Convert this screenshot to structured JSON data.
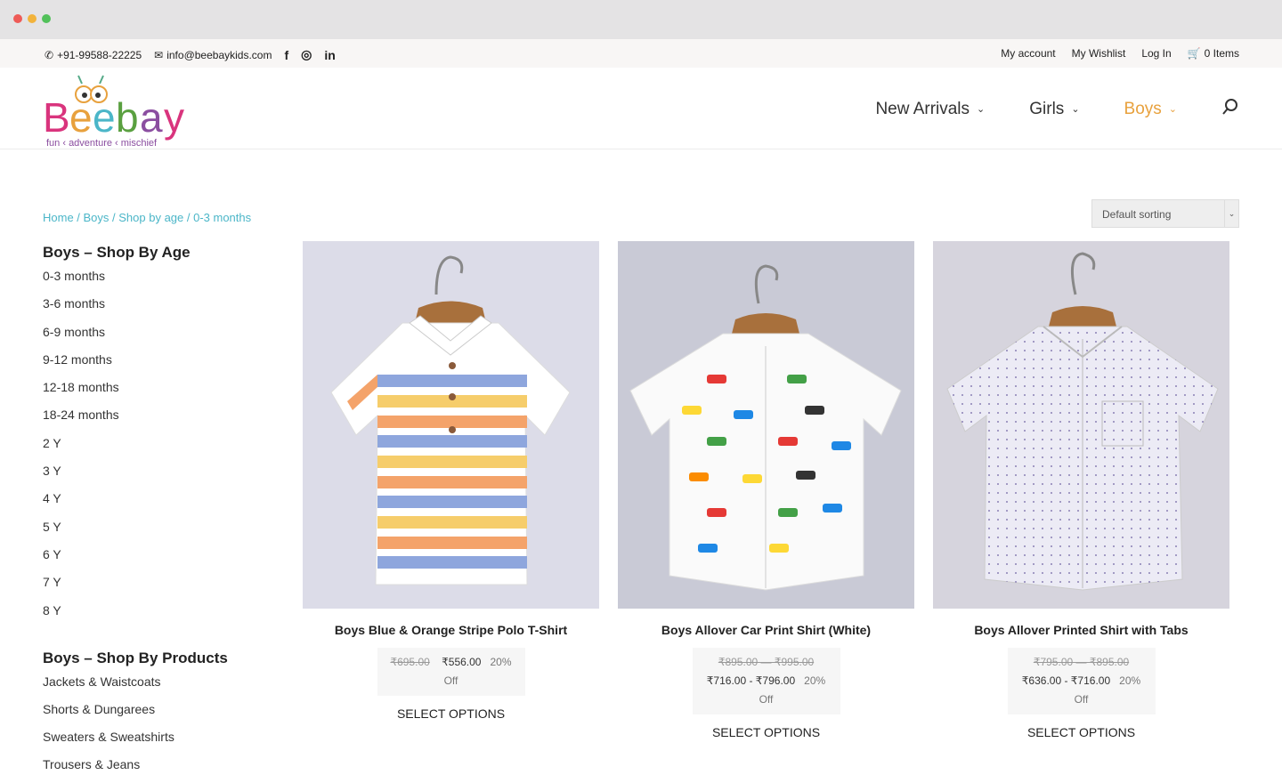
{
  "topbar": {
    "phone": "+91-99588-22225",
    "email": "info@beebaykids.com",
    "social": [
      "f",
      "◎",
      "in"
    ],
    "links": [
      "My account",
      "My Wishlist",
      "Log In"
    ],
    "cart": "0 Items"
  },
  "logo": {
    "text": "Beebay",
    "tagline": "fun ‹ adventure ‹ mischief"
  },
  "nav": {
    "items": [
      {
        "label": "New Arrivals"
      },
      {
        "label": "Girls"
      },
      {
        "label": "Boys"
      }
    ]
  },
  "breadcrumb": "Home / Boys / Shop by age / 0-3 months",
  "sorting": {
    "selected": "Default sorting"
  },
  "sidebar": {
    "age_title": "Boys – Shop By Age",
    "ages": [
      "0-3 months",
      "3-6 months",
      "6-9 months",
      "9-12 months",
      "12-18 months",
      "18-24 months",
      "2 Y",
      "3 Y",
      "4 Y",
      "5 Y",
      "6 Y",
      "7 Y",
      "8 Y"
    ],
    "products_title": "Boys – Shop By Products",
    "products": [
      "Jackets & Waistcoats",
      "Shorts & Dungarees",
      "Sweaters & Sweatshirts",
      "Trousers & Jeans"
    ]
  },
  "products": [
    {
      "name": "Boys Blue & Orange Stripe Polo T-Shirt",
      "old_price": "₹695.00",
      "price": "₹556.00",
      "discount": "20%",
      "off": "Off",
      "cta": "SELECT OPTIONS"
    },
    {
      "name": "Boys Allover Car Print Shirt (White)",
      "old_range": "₹895.00 — ₹995.00",
      "price_range": "₹716.00 - ₹796.00",
      "discount": "20%",
      "off": "Off",
      "cta": "SELECT OPTIONS"
    },
    {
      "name": "Boys Allover Printed Shirt with Tabs",
      "old_range": "₹795.00 — ₹895.00",
      "price_range": "₹636.00 - ₹716.00",
      "discount": "20%",
      "off": "Off",
      "cta": "SELECT OPTIONS"
    }
  ],
  "colors": {
    "accent": "#e8a13d",
    "link": "#4bb6c8"
  }
}
